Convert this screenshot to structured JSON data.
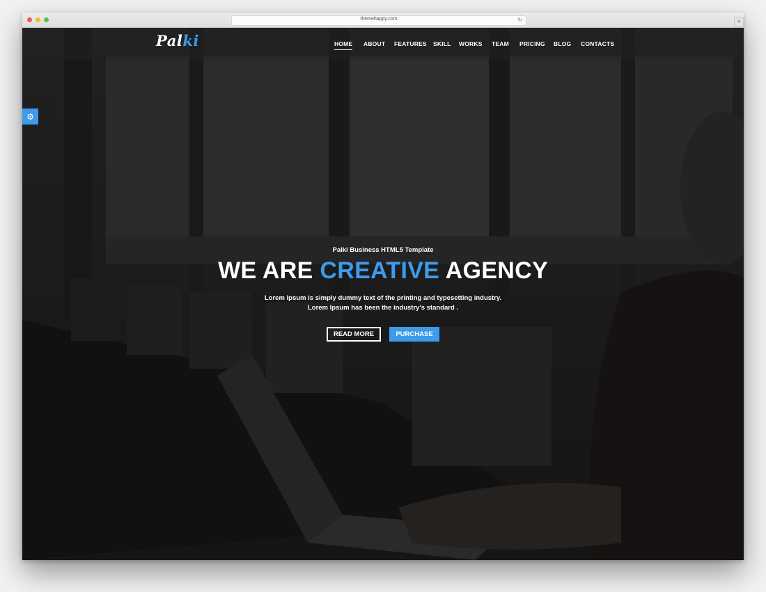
{
  "browser": {
    "url": "themehappy.com",
    "reload_icon": "reload-icon",
    "newtab_label": "+"
  },
  "site": {
    "logo_part1": "Pal",
    "logo_part2": "ki",
    "accent_color": "#3d9bea"
  },
  "nav": {
    "items": [
      {
        "label": "HOME",
        "active": true
      },
      {
        "label": "ABOUT"
      },
      {
        "label": "FEATURES"
      },
      {
        "label": "SKILL"
      },
      {
        "label": "WORKS"
      },
      {
        "label": "TEAM"
      },
      {
        "label": "PRICING"
      },
      {
        "label": "BLOG"
      },
      {
        "label": "CONTACTS"
      }
    ]
  },
  "settings": {
    "icon": "gear-icon",
    "glyph": "⚙"
  },
  "hero": {
    "eyebrow": "Palki Business HTML5 Template",
    "headline_part1": "WE ARE ",
    "headline_accent": "CREATIVE",
    "headline_part2": " AGENCY",
    "desc_line1": "Lorem Ipsum is simply dummy text of the printing and typesetting industry.",
    "desc_line2": "Lorem Ipsum has been the industry's standard .",
    "read_more": "READ MORE",
    "purchase": "PURCHASE"
  }
}
